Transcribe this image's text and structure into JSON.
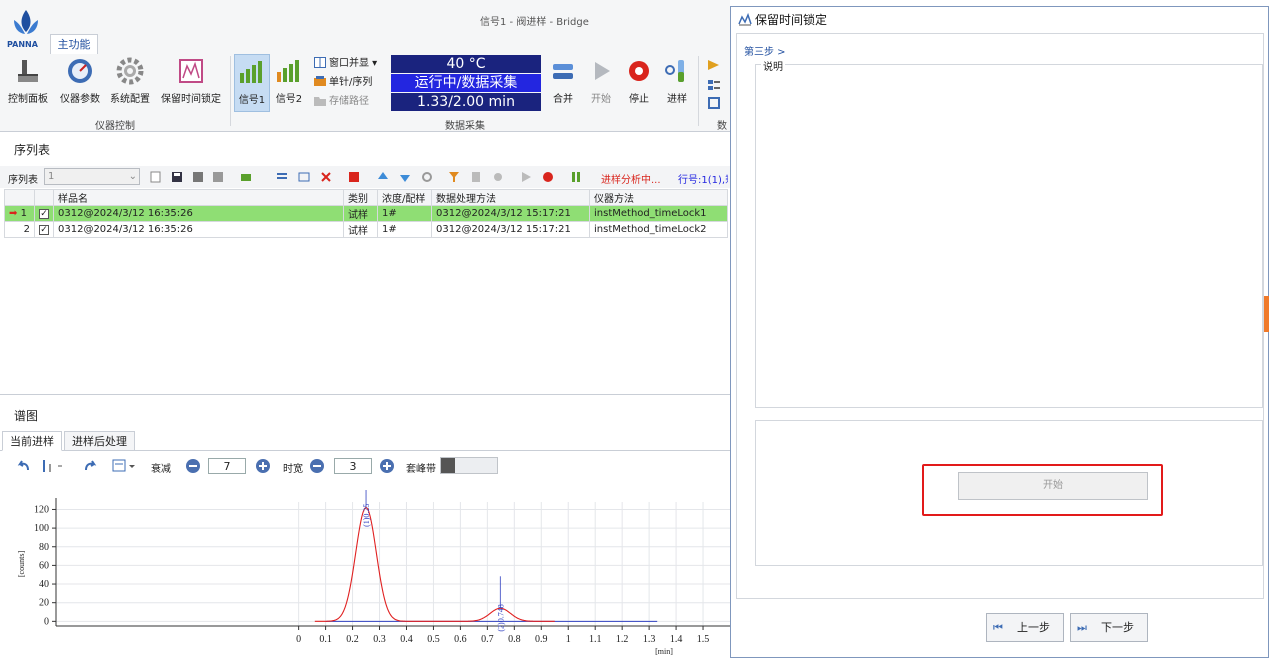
{
  "app": {
    "title": "信号1 - 阀进样 - Bridge",
    "logo_text": "PANNA",
    "tab_main": "主功能"
  },
  "ribbon": {
    "instrument_group": {
      "label": "仪器控制",
      "buttons": [
        "控制面板",
        "仪器参数",
        "系统配置",
        "保留时间锁定"
      ]
    },
    "signal_buttons": [
      "信号1",
      "信号2"
    ],
    "window_items": [
      "窗口并显 ▾",
      "单针/序列",
      "存储路径"
    ],
    "acquisition_group": {
      "label": "数据采集",
      "temperature": "40 °C",
      "status": "运行中/数据采集",
      "progress": "1.33/2.00 min"
    },
    "run_buttons": [
      "合并",
      "开始",
      "停止",
      "进样"
    ],
    "overflow_label": "数"
  },
  "sequence": {
    "panel_title": "序列表",
    "toolbar_label": "序列表",
    "selector_value": "1",
    "status_running": "进样分析中...",
    "status_row": "行号:1(1),剩",
    "columns": [
      "",
      "",
      "",
      "样品名",
      "类别",
      "浓度/配样",
      "数据处理方法",
      "仪器方法"
    ],
    "rows": [
      {
        "arrow": "➡",
        "index": "1",
        "sample": "0312@2024/3/12 16:35:26",
        "type": "试样",
        "conc": "1#",
        "process": "0312@2024/3/12 15:17:21",
        "instrument": "instMethod_timeLock1"
      },
      {
        "arrow": "",
        "index": "2",
        "sample": "0312@2024/3/12 16:35:26",
        "type": "试样",
        "conc": "1#",
        "process": "0312@2024/3/12 15:17:21",
        "instrument": "instMethod_timeLock2"
      }
    ]
  },
  "spectrum": {
    "panel_title": "谱图",
    "tabs": [
      "当前进样",
      "进样后处理"
    ],
    "attenuation_label": "衰减",
    "attenuation_value": "7",
    "time_width_label": "时宽",
    "time_width_value": "3",
    "peak_band_label": "套峰带"
  },
  "chart_data": {
    "type": "line",
    "title": "",
    "xlabel": "[min]",
    "ylabel": "[counts]",
    "xlim": [
      -0.9,
      1.6
    ],
    "ylim": [
      -5,
      128
    ],
    "xticks": [
      "0",
      "0.1",
      "0.2",
      "0.3",
      "0.4",
      "0.5",
      "0.6",
      "0.7",
      "0.8",
      "0.9",
      "1",
      "1.1",
      "1.2",
      "1.3",
      "1.4",
      "1.5"
    ],
    "yticks": [
      "0",
      "20",
      "40",
      "60",
      "80",
      "100",
      "120"
    ],
    "peaks": [
      {
        "center": 0.25,
        "height": 122,
        "width": 0.038,
        "label": "(1)0.25"
      },
      {
        "center": 0.748,
        "height": 14,
        "width": 0.038,
        "label": "(2)0.748"
      }
    ],
    "series_color": "#e02020",
    "baseline_color": "#3040c0",
    "baseline_end": 1.33
  },
  "dialog": {
    "title": "保留时间锁定",
    "step": "第三步 >",
    "description_label": "说明",
    "start_button": "开始",
    "prev_button": "上一步",
    "next_button": "下一步"
  }
}
